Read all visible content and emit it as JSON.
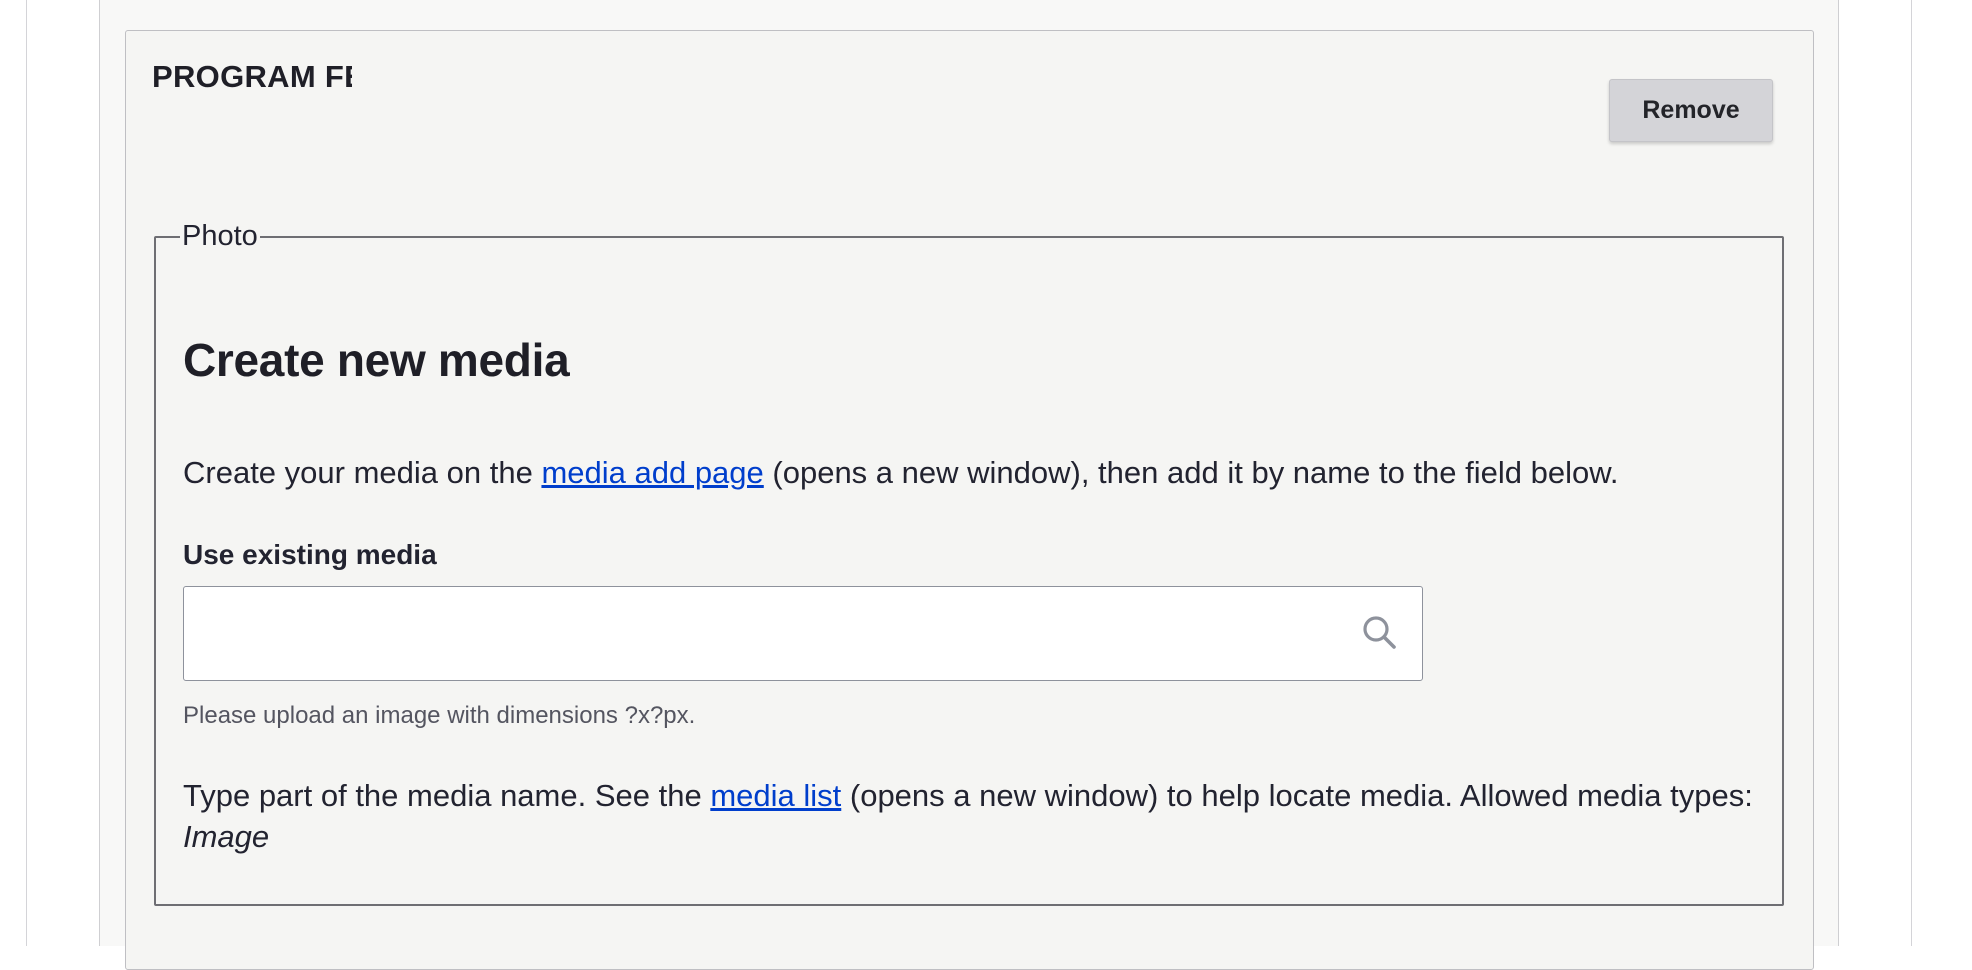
{
  "paragraph": {
    "title": "PROGRAM FE",
    "remove_label": "Remove"
  },
  "photo": {
    "legend": "Photo",
    "heading": "Create new media",
    "desc_prefix": "Create your media on the ",
    "desc_link": "media add page",
    "desc_suffix": " (opens a new window), then add it by name to the field below.",
    "field_label": "Use existing media",
    "input_value": "",
    "help_text": "Please upload an image with dimensions ?x?px.",
    "type_prefix": "Type part of the media name. See the ",
    "type_link": "media list",
    "type_suffix": " (opens a new window) to help locate media. Allowed media types: ",
    "allowed_types": "Image"
  },
  "colors": {
    "link": "#003ecc",
    "button_bg": "#d4d4d8",
    "panel_bg": "#f5f5f3"
  },
  "icons": {
    "search": "search-icon"
  }
}
